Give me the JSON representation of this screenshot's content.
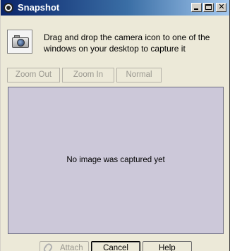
{
  "window": {
    "title": "Snapshot",
    "title_icon": "snapshot-lens-icon",
    "controls": [
      "minimize",
      "maximize",
      "close"
    ]
  },
  "instructions": {
    "icon": "camera-icon",
    "text": "Drag and drop the camera icon to one of the windows on your desktop to capture it"
  },
  "zoom_toolbar": {
    "zoom_out": "Zoom Out",
    "zoom_in": "Zoom In",
    "normal": "Normal",
    "enabled": false
  },
  "preview": {
    "message": "No image was captured yet",
    "background_color": "#ccc8d9"
  },
  "actions": {
    "attach": "Attach",
    "attach_icon": "paperclip-icon",
    "attach_enabled": false,
    "cancel": "Cancel",
    "help": "Help"
  },
  "colors": {
    "titlebar_start": "#0a246a",
    "titlebar_end": "#a6caf0",
    "window_bg": "#ece9d8",
    "disabled_text": "#9a9890"
  }
}
